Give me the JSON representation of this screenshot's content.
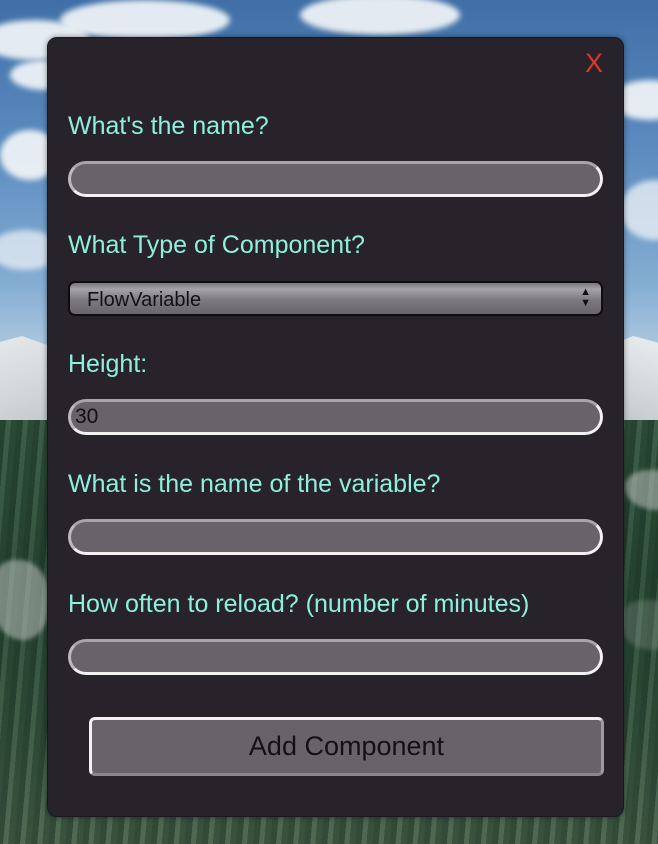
{
  "dialog": {
    "close_label": "X",
    "name_label": "What's the name?",
    "name_value": "",
    "type_label": "What Type of Component?",
    "type_selected": "FlowVariable",
    "height_label": "Height:",
    "height_value": "30",
    "variable_label": "What is the name of the variable?",
    "variable_value": "",
    "reload_label": "How often to reload? (number of minutes)",
    "reload_value": "",
    "submit_label": "Add Component"
  },
  "colors": {
    "label_text": "#8ef0dc",
    "close_icon": "#e0362a",
    "dialog_background": "#28232b",
    "input_background": "#68636a"
  },
  "icons": {
    "close": "close-icon",
    "select_arrows": "chevron-up-down-icon"
  }
}
